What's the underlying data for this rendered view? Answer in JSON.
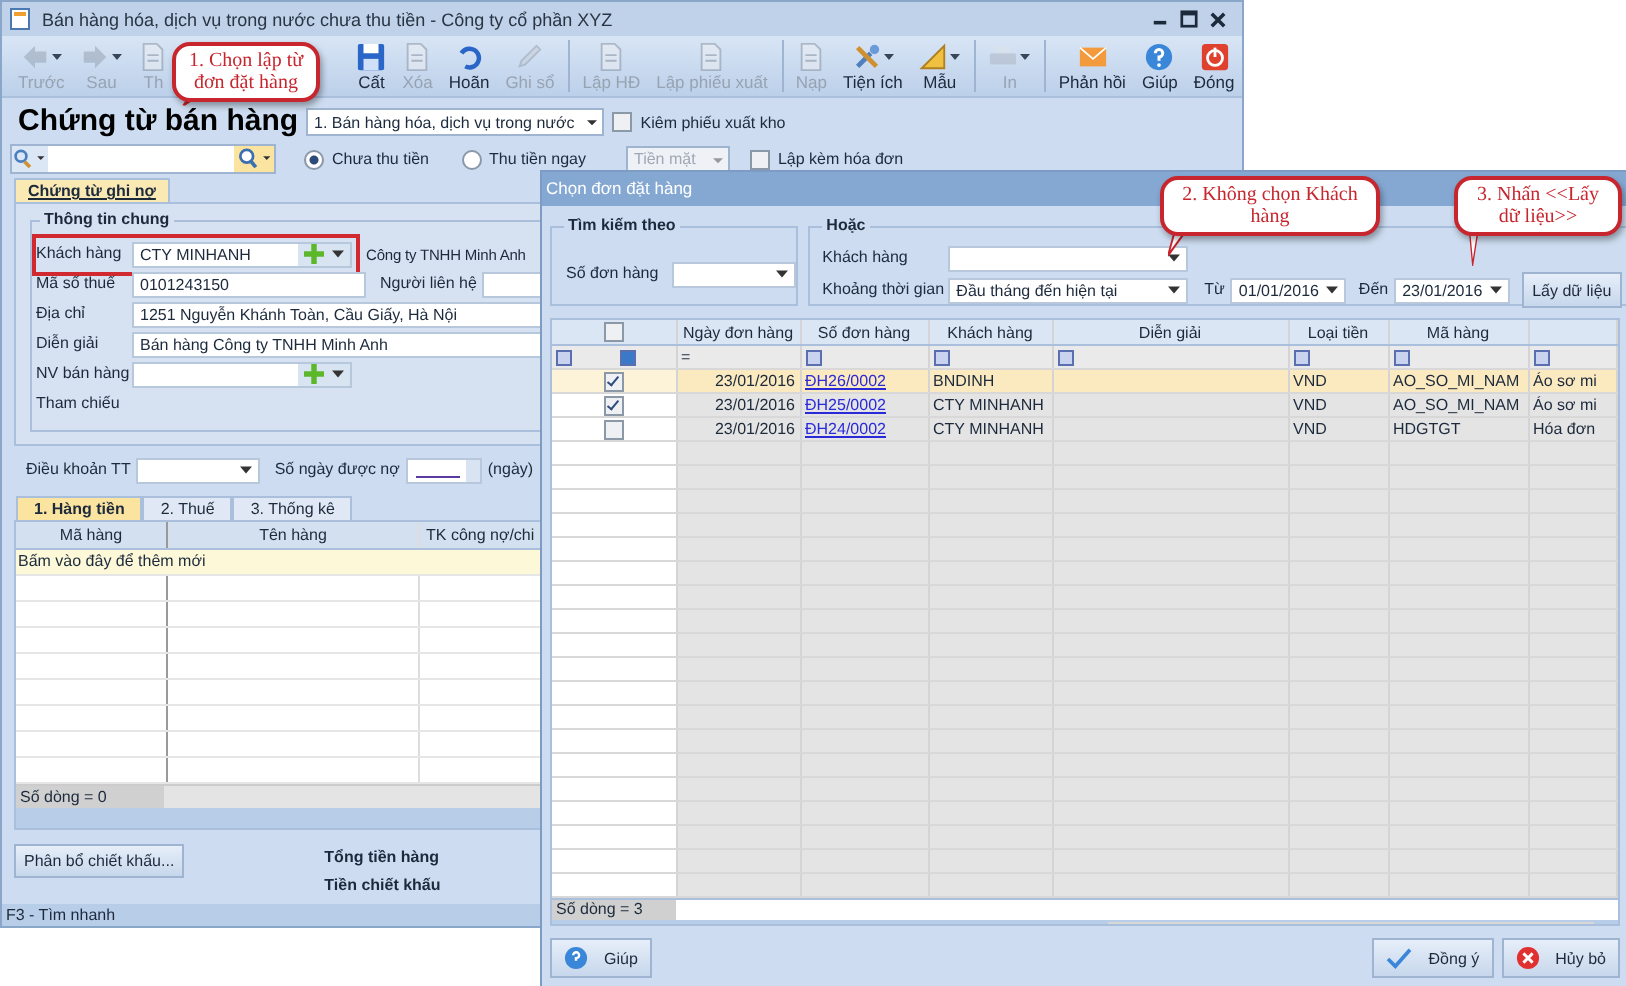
{
  "main_window": {
    "title": "Bán hàng hóa, dịch vụ trong nước chưa thu tiền - Công ty cổ phần XYZ",
    "toolbar": [
      {
        "label": "Trước",
        "kind": "back",
        "disabled": true,
        "dropdown": true,
        "separator_before": false
      },
      {
        "label": "Sau",
        "kind": "forward",
        "disabled": true,
        "dropdown": true,
        "separator_before": false
      },
      {
        "label": "Th",
        "kind": "add",
        "disabled": true,
        "dropdown": false,
        "separator_before": false
      },
      {
        "label": "Cất",
        "kind": "save",
        "disabled": false,
        "dropdown": false,
        "separator_before": false
      },
      {
        "label": "Xóa",
        "kind": "delete",
        "disabled": true,
        "dropdown": false,
        "separator_before": false
      },
      {
        "label": "Hoãn",
        "kind": "undo",
        "disabled": false,
        "dropdown": false,
        "separator_before": false
      },
      {
        "label": "Ghi sổ",
        "kind": "post",
        "disabled": true,
        "dropdown": false,
        "separator_before": false
      },
      {
        "label": "Lập HĐ",
        "kind": "invoice",
        "disabled": true,
        "dropdown": false,
        "separator_before": true
      },
      {
        "label": "Lập phiếu xuất",
        "kind": "export",
        "disabled": true,
        "dropdown": false,
        "separator_before": false
      },
      {
        "label": "Nạp",
        "kind": "reload",
        "disabled": true,
        "dropdown": false,
        "separator_before": true
      },
      {
        "label": "Tiện ích",
        "kind": "tools",
        "disabled": false,
        "dropdown": true,
        "separator_before": false
      },
      {
        "label": "Mẫu",
        "kind": "template",
        "disabled": false,
        "dropdown": true,
        "separator_before": false
      },
      {
        "label": "In",
        "kind": "print",
        "disabled": true,
        "dropdown": true,
        "separator_before": true
      },
      {
        "label": "Phản hồi",
        "kind": "feedback",
        "disabled": false,
        "dropdown": false,
        "separator_before": true
      },
      {
        "label": "Giúp",
        "kind": "help",
        "disabled": false,
        "dropdown": false,
        "separator_before": false
      },
      {
        "label": "Đóng",
        "kind": "close",
        "disabled": false,
        "dropdown": false,
        "separator_before": false
      }
    ],
    "heading": "Chứng từ bán hàng",
    "voucher_type": "1. Bán hàng hóa, dịch vụ trong nước",
    "export_slip": {
      "label": "Kiêm phiếu xuất kho",
      "checked": false
    },
    "payment": [
      {
        "label": "Chưa thu tiền",
        "selected": true
      },
      {
        "label": "Thu tiền ngay",
        "selected": false
      }
    ],
    "payment_method": {
      "value": "Tiền mặt",
      "disabled": true
    },
    "invoice_with": {
      "label": "Lập kèm hóa đơn",
      "checked": false
    },
    "tabs": [
      {
        "label": "Chứng từ ghi nợ",
        "selected": true
      }
    ],
    "general_info": {
      "title": "Thông tin chung",
      "customer": {
        "label": "Khách hàng",
        "code": "CTY MINHANH",
        "name": "Công ty TNHH Minh Anh"
      },
      "tax_code": {
        "label": "Mã số thuế",
        "value": "0101243150"
      },
      "contact": {
        "label": "Người liên hệ"
      },
      "address": {
        "label": "Địa chỉ",
        "value": "1251 Nguyễn Khánh Toàn, Cầu Giấy, Hà Nội"
      },
      "description": {
        "label": "Diễn giải",
        "value": "Bán hàng Công ty TNHH Minh Anh"
      },
      "salesperson": {
        "label": "NV bán hàng"
      },
      "reference": {
        "label": "Tham chiếu"
      }
    },
    "payment_terms": {
      "label": "Điều khoản TT"
    },
    "credit_days": {
      "label": "Số ngày được nợ",
      "unit": "(ngày)"
    },
    "detail_tabs": [
      {
        "label": "1. Hàng tiền",
        "selected": true
      },
      {
        "label": "2. Thuế",
        "selected": false
      },
      {
        "label": "3. Thống kê",
        "selected": false
      }
    ],
    "grid": {
      "columns": [
        "Mã hàng",
        "Tên hàng",
        "TK công nợ/chi"
      ],
      "new_row": "Bấm vào đây để thêm mới",
      "row_count": "Số dòng = 0"
    },
    "allocate_button": "Phân bổ chiết khấu...",
    "totals": [
      "Tổng tiền hàng",
      "Tiền chiết khấu"
    ],
    "status_bar": "F3 - Tìm nhanh"
  },
  "dialog": {
    "title": "Chọn đơn đặt hàng",
    "search_by": {
      "title": "Tìm kiếm theo",
      "order_label": "Số đơn hàng"
    },
    "or": {
      "title": "Hoặc",
      "customer_label": "Khách hàng",
      "period_label": "Khoảng thời gian",
      "period": "Đầu tháng đến hiện tại",
      "from_label": "Từ",
      "from": "01/01/2016",
      "to_label": "Đến",
      "to": "23/01/2016",
      "fetch_button": "Lấy dữ liệu"
    },
    "grid": {
      "all_checked": false,
      "columns": [
        "Ngày đơn hàng",
        "Số đơn hàng",
        "Khách hàng",
        "Diễn giải",
        "Loại tiền",
        "Mã hàng"
      ],
      "date_filter": "=",
      "rows": [
        {
          "checked": true,
          "selected": true,
          "date": "23/01/2016",
          "order_no": "ĐH26/0002",
          "customer": "BNDINH",
          "currency": "VND",
          "item_code": "AO_SO_MI_NAM",
          "column_8": "Áo sơ mi"
        },
        {
          "checked": true,
          "selected": false,
          "date": "23/01/2016",
          "order_no": "ĐH25/0002",
          "customer": "CTY MINHANH",
          "currency": "VND",
          "item_code": "AO_SO_MI_NAM",
          "column_8": "Áo sơ mi"
        },
        {
          "checked": false,
          "selected": false,
          "date": "23/01/2016",
          "order_no": "ĐH24/0002",
          "customer": "CTY MINHANH",
          "currency": "VND",
          "item_code": "HDGTGT",
          "column_8": "Hóa đơn"
        }
      ],
      "row_count": "Số dòng = 3"
    },
    "buttons": {
      "help": "Giúp",
      "ok": "Đồng ý",
      "cancel": "Hủy bỏ"
    }
  },
  "callouts": [
    {
      "text": "1. Chọn lập từ đơn đặt hàng"
    },
    {
      "text": "2. Không chọn Khách hàng"
    },
    {
      "text": "3. Nhấn <<Lấy dữ liệu>>"
    }
  ]
}
